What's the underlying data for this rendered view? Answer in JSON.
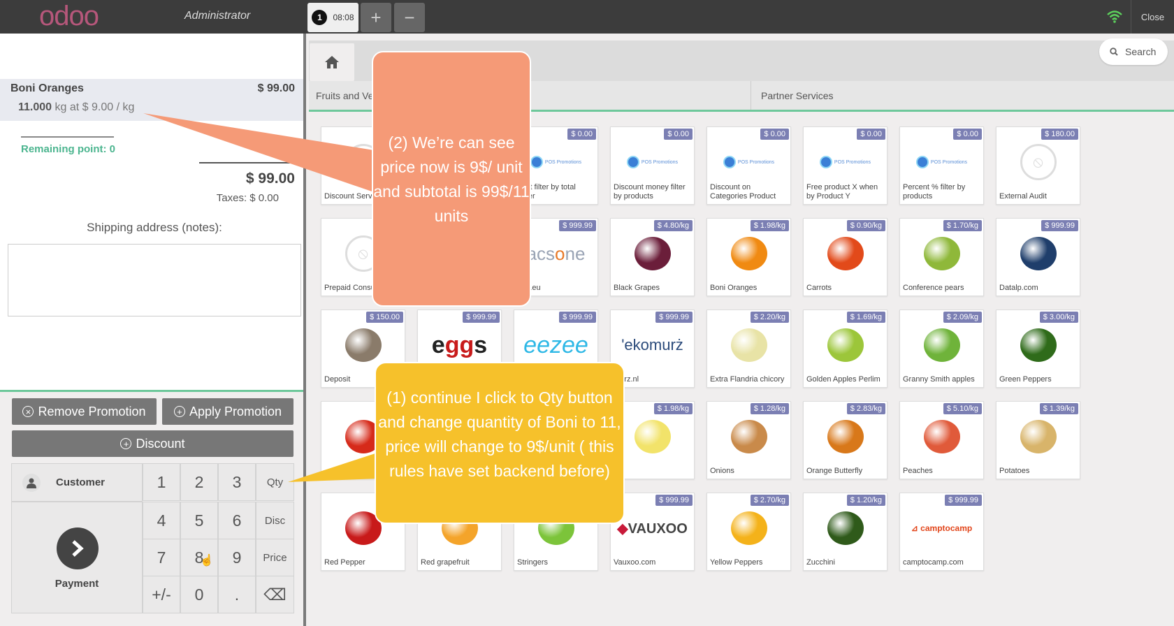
{
  "topbar": {
    "logo": "odoo",
    "user": "Administrator",
    "order_number": "1",
    "order_time": "08:08",
    "add_label": "+",
    "remove_label": "−",
    "close_label": "Close"
  },
  "order": {
    "line": {
      "product": "Boni Oranges",
      "price": "$ 99.00",
      "qty": "11.000",
      "unit_info": "kg at $ 9.00 / kg"
    },
    "remaining_points": "Remaining point: 0",
    "total": "$ 99.00",
    "taxes": "Taxes: $ 0.00",
    "shipping_label": "Shipping address (notes):"
  },
  "actions": {
    "remove_promotion": "Remove Promotion",
    "apply_promotion": "Apply Promotion",
    "discount": "Discount"
  },
  "numpad": {
    "customer": "Customer",
    "payment": "Payment",
    "keys": [
      "1",
      "2",
      "3",
      "Qty",
      "4",
      "5",
      "6",
      "Disc",
      "7",
      "8",
      "9",
      "Price",
      "+/-",
      "0",
      ".",
      "⌫"
    ]
  },
  "search": {
    "label": "Search"
  },
  "categories": [
    "Fruits and Ve",
    "Partner Services"
  ],
  "products": [
    {
      "name": "Discount Serv",
      "price": "",
      "img": "noimg"
    },
    {
      "name": "",
      "price": "",
      "img": "none"
    },
    {
      "name": "ount filter by total order",
      "price": "$ 0.00",
      "img": "posp"
    },
    {
      "name": "Discount money filter by products",
      "price": "$ 0.00",
      "img": "posp"
    },
    {
      "name": "Discount on Categories Product",
      "price": "$ 0.00",
      "img": "posp"
    },
    {
      "name": "Free product X when by Product Y",
      "price": "$ 0.00",
      "img": "posp"
    },
    {
      "name": "Percent % filter by products",
      "price": "$ 0.00",
      "img": "posp"
    },
    {
      "name": "External Audit",
      "price": "$ 180.00",
      "img": "noimg"
    },
    {
      "name": "Prepaid Consu",
      "price": "",
      "img": "noimg"
    },
    {
      "name": "",
      "price": "",
      "img": "none"
    },
    {
      "name": "one.eu",
      "price": "$ 999.99",
      "img": "acsone"
    },
    {
      "name": "Black Grapes",
      "price": "$ 4.80/kg",
      "img": "#6b1e3a"
    },
    {
      "name": "Boni Oranges",
      "price": "$ 1.98/kg",
      "img": "#f08a12"
    },
    {
      "name": "Carrots",
      "price": "$ 0.90/kg",
      "img": "#e24a1a"
    },
    {
      "name": "Conference pears",
      "price": "$ 1.70/kg",
      "img": "#8fb83a"
    },
    {
      "name": "Datalp.com",
      "price": "$ 999.99",
      "img": "#1f3e6b"
    },
    {
      "name": "Deposit",
      "price": "$ 150.00",
      "img": "#8a7b6a"
    },
    {
      "name": "",
      "price": "$ 999.99",
      "img": "eggs"
    },
    {
      "name": "",
      "price": "$ 999.99",
      "img": "eezee"
    },
    {
      "name": "murz.nl",
      "price": "$ 999.99",
      "img": "ekomurz"
    },
    {
      "name": "Extra Flandria chicory",
      "price": "$ 2.20/kg",
      "img": "#e8e3a6"
    },
    {
      "name": "Golden Apples Perlim",
      "price": "$ 1.69/kg",
      "img": "#9cc63a"
    },
    {
      "name": "Granny Smith apples",
      "price": "$ 2.09/kg",
      "img": "#6fb33a"
    },
    {
      "name": "Green Peppers",
      "price": "$ 3.00/kg",
      "img": "#2f6b1a"
    },
    {
      "name": "",
      "price": "$",
      "img": "#d62a1a"
    },
    {
      "name": "",
      "price": "",
      "img": "none"
    },
    {
      "name": "",
      "price": "",
      "img": "none"
    },
    {
      "name": "on",
      "price": "$ 1.98/kg",
      "img": "#f2e36a"
    },
    {
      "name": "Onions",
      "price": "$ 1.28/kg",
      "img": "#c98a4a"
    },
    {
      "name": "Orange Butterfly",
      "price": "$ 2.83/kg",
      "img": "#d8781a"
    },
    {
      "name": "Peaches",
      "price": "$ 5.10/kg",
      "img": "#e05a3a"
    },
    {
      "name": "Potatoes",
      "price": "$ 1.39/kg",
      "img": "#d8b46a"
    },
    {
      "name": "Red Pepper",
      "price": "$",
      "img": "#c81a1a"
    },
    {
      "name": "Red grapefruit",
      "price": "",
      "img": "#f4a42a"
    },
    {
      "name": "Stringers",
      "price": "",
      "img": "#7cc43a"
    },
    {
      "name": "Vauxoo.com",
      "price": "$ 999.99",
      "img": "vauxoo"
    },
    {
      "name": "Yellow Peppers",
      "price": "$ 2.70/kg",
      "img": "#f4b21a"
    },
    {
      "name": "Zucchini",
      "price": "$ 1.20/kg",
      "img": "#2f5a1a"
    },
    {
      "name": "camptocamp.com",
      "price": "$ 999.99",
      "img": "camptocamp"
    }
  ],
  "callouts": {
    "c1": "(2) We’re can see price now is 9$/ unit and subtotal is 99$/11 units",
    "c2": "(1) continue I click to Qty button and change quantity of Boni to 11, price will change to 9$/unit ( this rules have set backend before)"
  },
  "colors": {
    "accent": "#6ec89b",
    "badge": "#7b7fb3",
    "callout1": "#f59a77",
    "callout2": "#f6c12b"
  }
}
